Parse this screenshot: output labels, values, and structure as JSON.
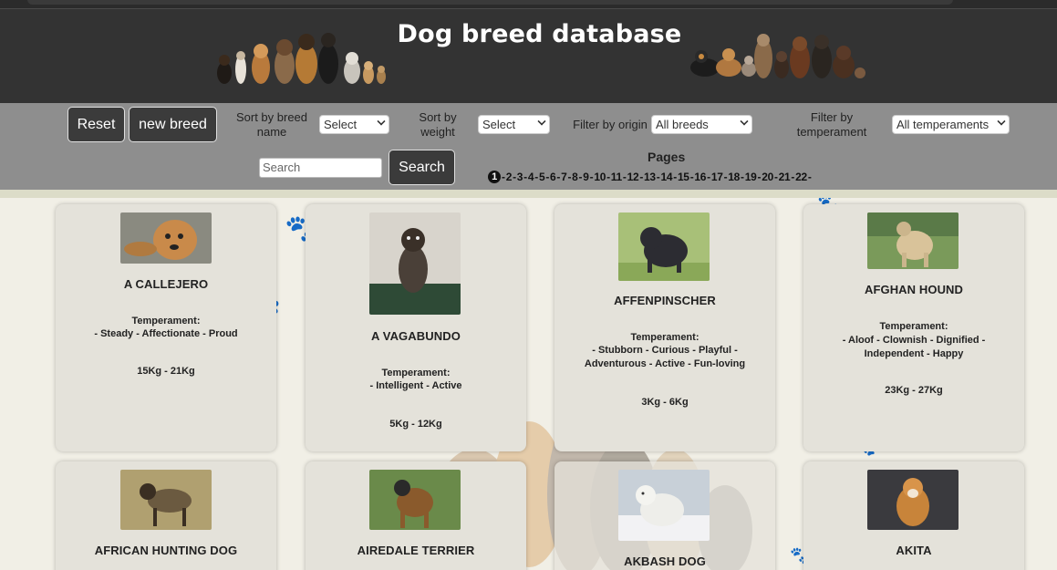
{
  "header": {
    "title": "Dog breed database"
  },
  "toolbar": {
    "reset_label": "Reset",
    "new_breed_label": "new breed",
    "sort_name_label": "Sort by breed name",
    "sort_name_value": "Select",
    "sort_weight_label": "Sort by weight",
    "sort_weight_value": "Select",
    "origin_label": "Filter by origin",
    "origin_value": "All breeds",
    "temperament_label": "Filter by temperament",
    "temperament_value": "All temperaments",
    "search_placeholder": "Search",
    "search_button": "Search",
    "pages_label": "Pages",
    "current_page": "1",
    "pages": [
      "2",
      "3",
      "4",
      "5",
      "6",
      "7",
      "8",
      "9",
      "10",
      "11",
      "12",
      "13",
      "14",
      "15",
      "16",
      "17",
      "18",
      "19",
      "20",
      "21",
      "22"
    ]
  },
  "cards": [
    {
      "name": "A CALLEJERO",
      "temperament_label": "Temperament:",
      "temperament": "- Steady - Affectionate - Proud",
      "weight": "15Kg - 21Kg",
      "color": "#c98a4a"
    },
    {
      "name": "A VAGABUNDO",
      "temperament_label": "Temperament:",
      "temperament": "- Intelligent - Active",
      "weight": "5Kg - 12Kg",
      "color": "#4a4038"
    },
    {
      "name": "AFFENPINSCHER",
      "temperament_label": "Temperament:",
      "temperament": "- Stubborn - Curious - Playful - Adventurous - Active - Fun-loving",
      "weight": "3Kg - 6Kg",
      "color": "#2c2c32"
    },
    {
      "name": "AFGHAN HOUND",
      "temperament_label": "Temperament:",
      "temperament": "- Aloof - Clownish - Dignified - Independent - Happy",
      "weight": "23Kg - 27Kg",
      "color": "#d9c39a"
    },
    {
      "name": "AFRICAN HUNTING DOG",
      "color": "#6b5a40"
    },
    {
      "name": "AIREDALE TERRIER",
      "color": "#8a5a2c"
    },
    {
      "name": "AKBASH DOG",
      "color": "#eeeeea"
    },
    {
      "name": "AKITA",
      "color": "#c8843a"
    }
  ],
  "colors": {
    "header_bg": "#333333",
    "toolbar_bg": "#8e8e8e",
    "page_bg": "#f1efe6",
    "card_bg": "#e4e2da",
    "button_bg": "#3b3b3b"
  },
  "icons": [
    "paw-print-icon",
    "dog-group-illustration",
    "chevron-down-icon"
  ]
}
